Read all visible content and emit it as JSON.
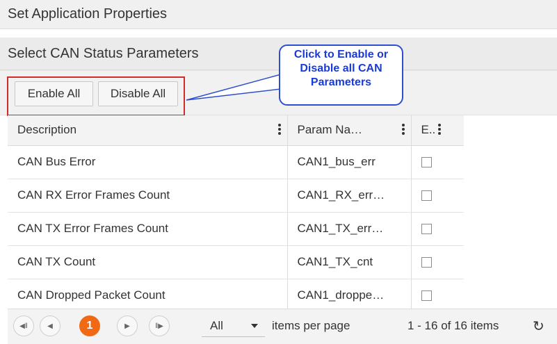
{
  "headers": {
    "app_properties": "Set Application Properties",
    "can_status": "Select CAN Status Parameters"
  },
  "toolbar": {
    "enable_all": "Enable All",
    "disable_all": "Disable All"
  },
  "callout": {
    "line1": "Click to Enable or",
    "line2": "Disable all CAN",
    "line3": "Parameters"
  },
  "grid": {
    "columns": [
      "Description",
      "Param Na…",
      "E.."
    ],
    "rows": [
      {
        "description": "CAN Bus Error",
        "param": "CAN1_bus_err",
        "enabled": false
      },
      {
        "description": "CAN RX Error Frames Count",
        "param": "CAN1_RX_err…",
        "enabled": false
      },
      {
        "description": "CAN TX Error Frames Count",
        "param": "CAN1_TX_err…",
        "enabled": false
      },
      {
        "description": "CAN TX Count",
        "param": "CAN1_TX_cnt",
        "enabled": false
      },
      {
        "description": "CAN Dropped Packet Count",
        "param": "CAN1_droppe…",
        "enabled": false
      }
    ]
  },
  "pager": {
    "current_page": "1",
    "page_size": "All",
    "items_per_page_label": "items per page",
    "summary": "1 - 16 of 16 items"
  },
  "icons": {
    "first": "first-page-icon",
    "prev": "previous-page-icon",
    "next": "next-page-icon",
    "last": "last-page-icon",
    "refresh": "refresh-icon",
    "column_menu": "kebab-menu-icon"
  },
  "colors": {
    "accent": "#f06a16",
    "callout": "#1a3ad6",
    "highlight_box": "#d02a2a"
  }
}
